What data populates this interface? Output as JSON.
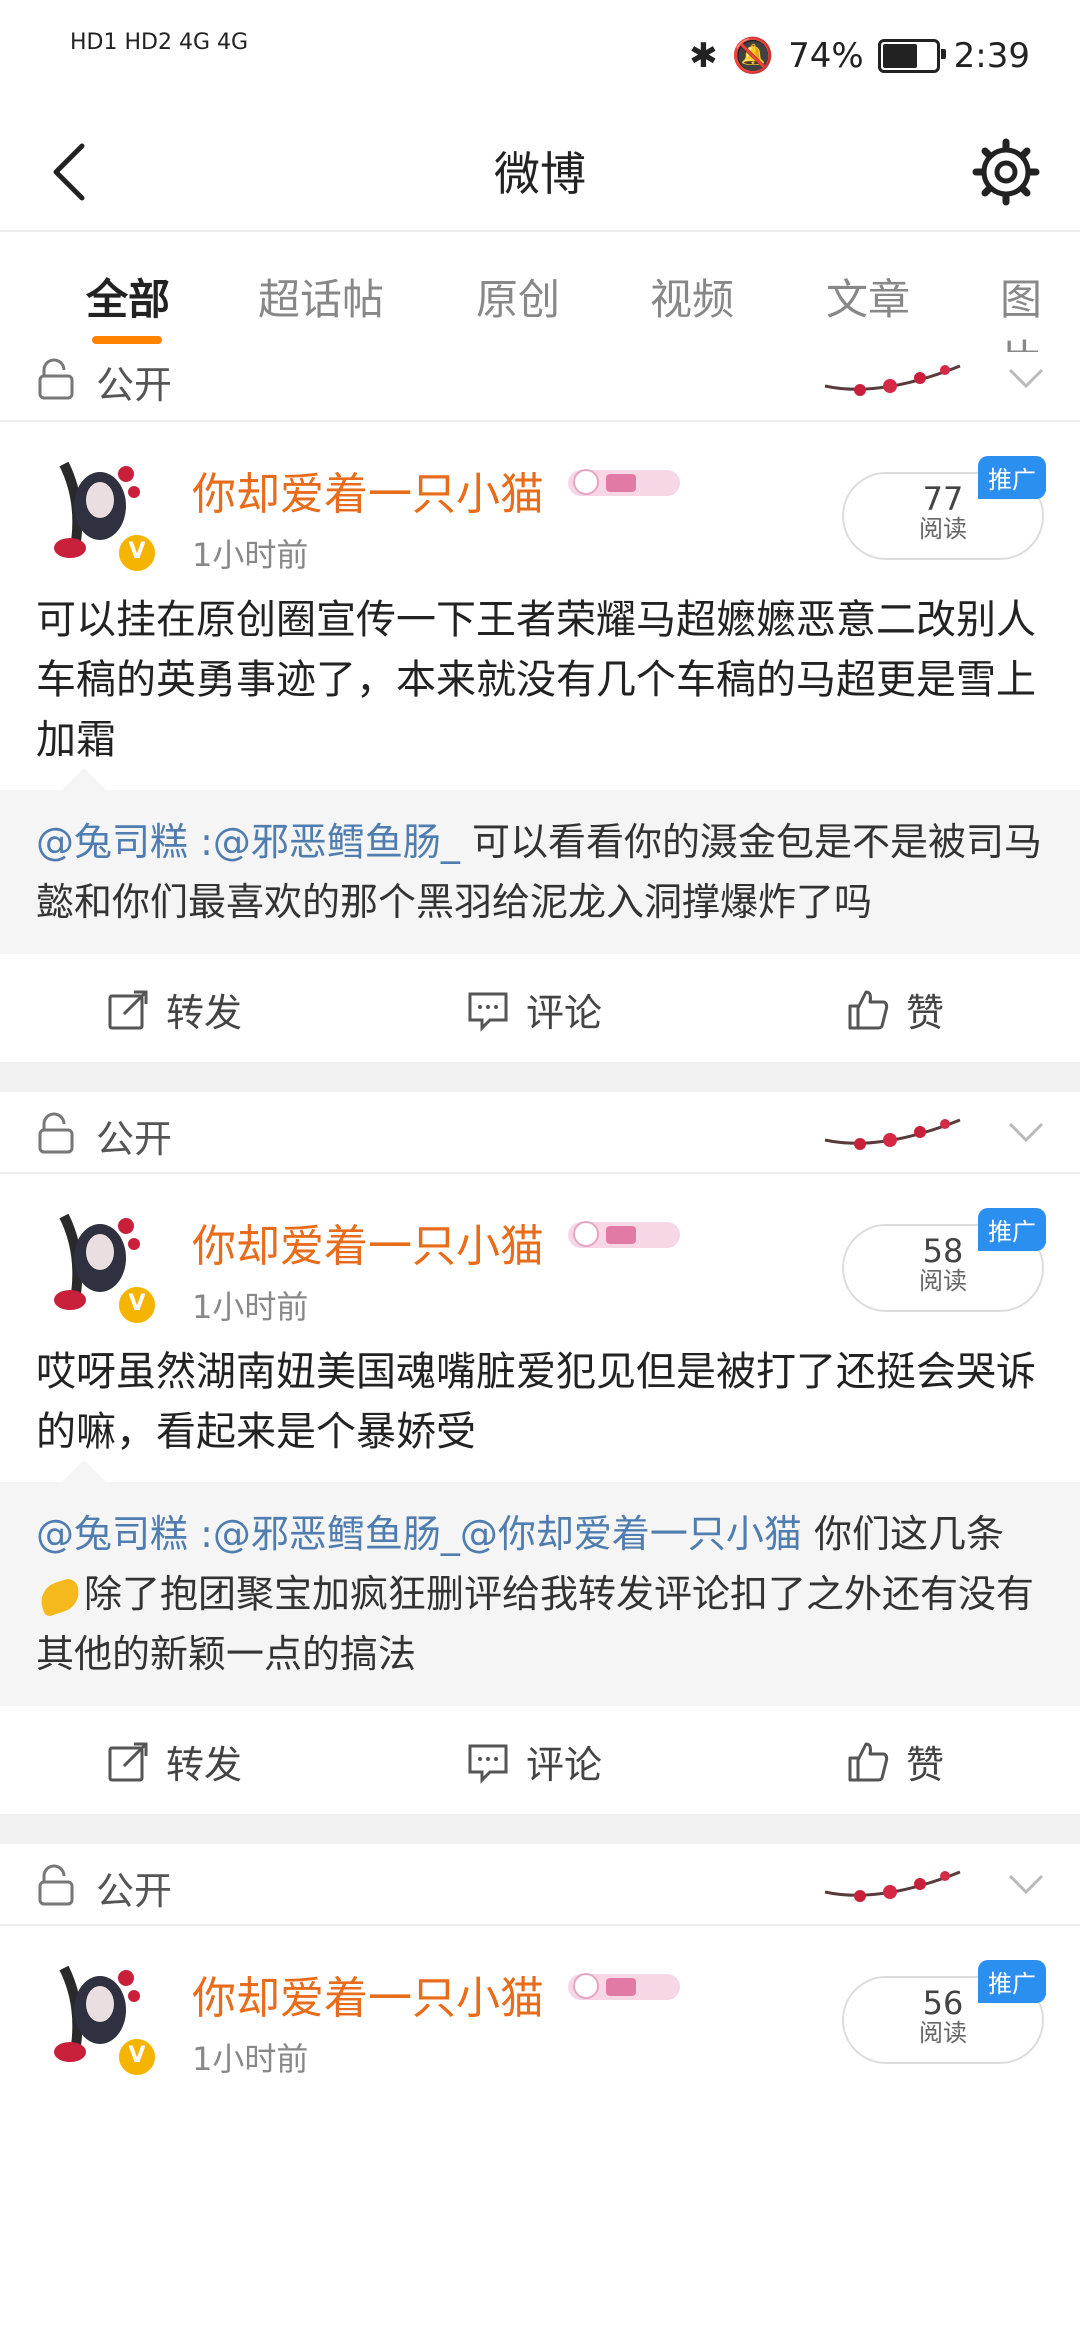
{
  "status": {
    "left": "HD1 HD2 4G 4G",
    "battery": "74%",
    "battery_fill": 0.74,
    "time": "2:39"
  },
  "header": {
    "title": "微博"
  },
  "tabs": [
    {
      "label": "全部",
      "active": true
    },
    {
      "label": "超话帖"
    },
    {
      "label": "原创"
    },
    {
      "label": "视频"
    },
    {
      "label": "文章"
    },
    {
      "label": "图片"
    }
  ],
  "visibility_label": "公开",
  "posts": [
    {
      "user": "你却爱着一只小猫",
      "time": "1小时前",
      "reads": "77",
      "reads_label": "阅读",
      "promo": "推广",
      "content": "可以挂在原创圈宣传一下王者荣耀马超嬷嬷恶意二改别人车稿的英勇事迹了，本来就没有几个车稿的马超更是雪上加霜",
      "repost_mention": "@兔司糕 :@邪恶鳕鱼肠_",
      "repost_text": " 可以看看你的滠金包是不是被司马懿和你们最喜欢的那个黑羽给泥龙入洞撑爆炸了吗"
    },
    {
      "user": "你却爱着一只小猫",
      "time": "1小时前",
      "reads": "58",
      "reads_label": "阅读",
      "promo": "推广",
      "content": "哎呀虽然湖南妞美国魂嘴脏爱犯见但是被打了还挺会哭诉的嘛，看起来是个暴娇受",
      "repost_mention": "@兔司糕 :@邪恶鳕鱼肠_@你却爱着一只小猫",
      "repost_text_a": " 你们这几条",
      "repost_text_b": "除了抱团聚宝加疯狂删评给我转发评论扣了之外还有没有其他的新颖一点的搞法"
    },
    {
      "user": "你却爱着一只小猫",
      "time": "1小时前",
      "reads": "56",
      "reads_label": "阅读",
      "promo": "推广"
    }
  ],
  "actions": {
    "repost": "转发",
    "comment": "评论",
    "like": "赞"
  }
}
